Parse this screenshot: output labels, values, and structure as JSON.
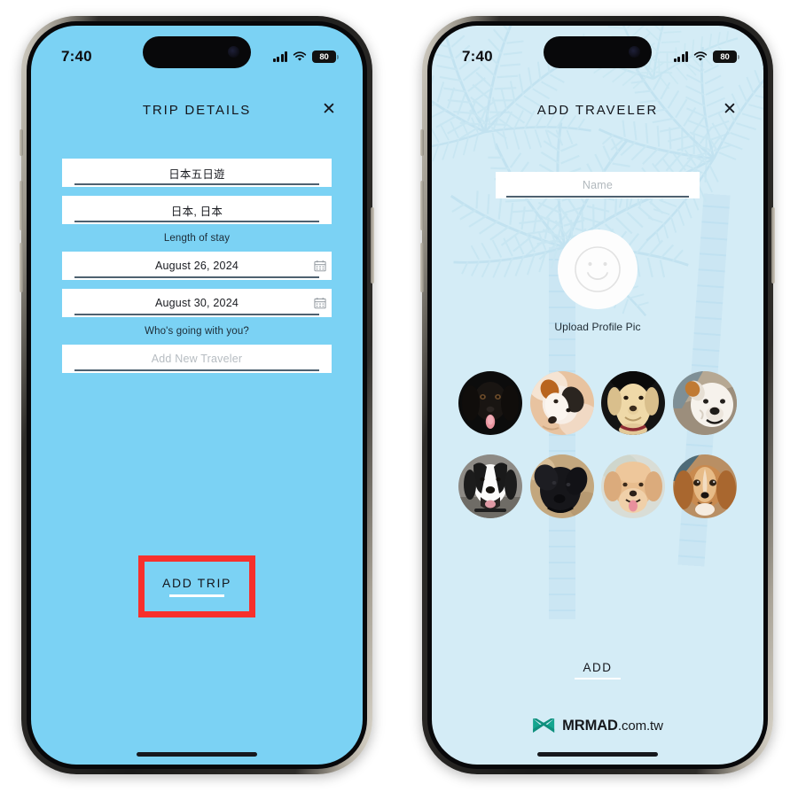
{
  "left_phone": {
    "status_bar": {
      "time": "7:40",
      "battery_level": "80",
      "signal_icon": "cellular-bars-icon",
      "wifi_icon": "wifi-icon"
    },
    "header": {
      "title": "TRIP DETAILS",
      "close_icon": "close-icon"
    },
    "form": {
      "trip_name": {
        "value": "日本五日遊"
      },
      "destination": {
        "value": "日本, 日本"
      },
      "length_of_stay_label": "Length of stay",
      "start_date": {
        "value": "August 26, 2024",
        "icon": "calendar-icon"
      },
      "end_date": {
        "value": "August 30, 2024",
        "icon": "calendar-icon"
      },
      "travelers_label": "Who's going with you?",
      "add_traveler": {
        "placeholder": "Add New Traveler"
      }
    },
    "primary_button": {
      "label": "ADD TRIP",
      "highlight_color": "#f7302c"
    },
    "screen_color": "#7bd2f4"
  },
  "right_phone": {
    "status_bar": {
      "time": "7:40",
      "battery_level": "80",
      "signal_icon": "cellular-bars-icon",
      "wifi_icon": "wifi-icon"
    },
    "header": {
      "title": "ADD TRAVELER",
      "close_icon": "close-icon"
    },
    "name_field": {
      "placeholder": "Name"
    },
    "upload": {
      "label": "Upload Profile Pic",
      "icon": "smiley-face-icon"
    },
    "avatars": [
      {
        "name": "black-spaniel-avatar"
      },
      {
        "name": "jack-russell-terrier-avatar"
      },
      {
        "name": "yellow-labrador-avatar"
      },
      {
        "name": "english-bulldog-avatar"
      },
      {
        "name": "black-white-pointer-avatar"
      },
      {
        "name": "black-labradoodle-avatar"
      },
      {
        "name": "apricot-poodle-avatar"
      },
      {
        "name": "cavalier-spaniel-avatar"
      }
    ],
    "primary_button": {
      "label": "ADD"
    },
    "watermark": {
      "brand": "MRMAD",
      "suffix": ".com.tw",
      "logo_icon": "mrmad-butterfly-logo",
      "logo_color": "#18a893"
    },
    "screen_color": "#d4ecf6"
  }
}
